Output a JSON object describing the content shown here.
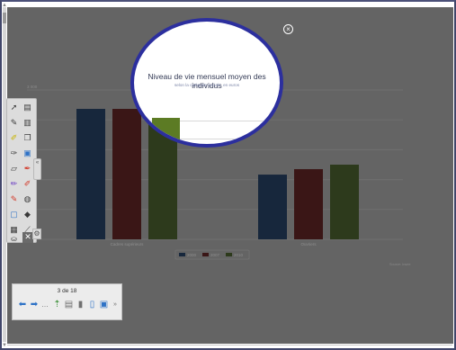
{
  "spotlight": {
    "title": "Niveau de vie mensuel moyen des individus",
    "subtitle": "selon la catégorie sociale, en euros"
  },
  "icons": {
    "close": "close-circle-icon",
    "tools": [
      "select-arrow-icon",
      "page-icon",
      "pen-arrow-icon",
      "document-icon",
      "highlighter-icon",
      "copy-page-icon",
      "eraser-pen-icon",
      "screen-icon",
      "eraser-icon",
      "pen-icon",
      "magic-pen-icon",
      "lasso-icon",
      "red-marker-icon",
      "line-icon",
      "shape-icon",
      "fill-icon",
      "table-icon",
      "resize-icon",
      "stamp-icon",
      "close-x-icon"
    ],
    "navigator": [
      "previous-page-icon",
      "next-page-icon",
      "more-icon",
      "add-page-icon",
      "page-sorter-icon",
      "delete-page-icon",
      "page-options-icon",
      "display-icon",
      "expand-icon"
    ]
  },
  "colors": {
    "series_2000": "#17273c",
    "series_2007": "#3a1616",
    "series_2010": "#2d3a1c",
    "stage": "#646464",
    "spotlight_border": "#2c2f9e"
  },
  "toolbar": {
    "collapse_label": "«",
    "gear_label": "⚙"
  },
  "navigator": {
    "page_indicator": "3 de 18"
  },
  "chart_data": {
    "type": "bar",
    "title": "Niveau de vie mensuel moyen des individus",
    "subtitle": "selon la catégorie sociale, en euros",
    "ytick_top": "3 000",
    "categories": [
      "Cadres supérieurs",
      "Ouvriers"
    ],
    "series": [
      {
        "name": "2000",
        "values": [
          2620,
          1300
        ]
      },
      {
        "name": "2007",
        "values": [
          2620,
          1410
        ]
      },
      {
        "name": "2010",
        "values": [
          2800,
          1500
        ]
      }
    ],
    "ylim": [
      0,
      3000
    ],
    "grid": true,
    "legend": "bottom-center",
    "source": "Source: Insee"
  }
}
